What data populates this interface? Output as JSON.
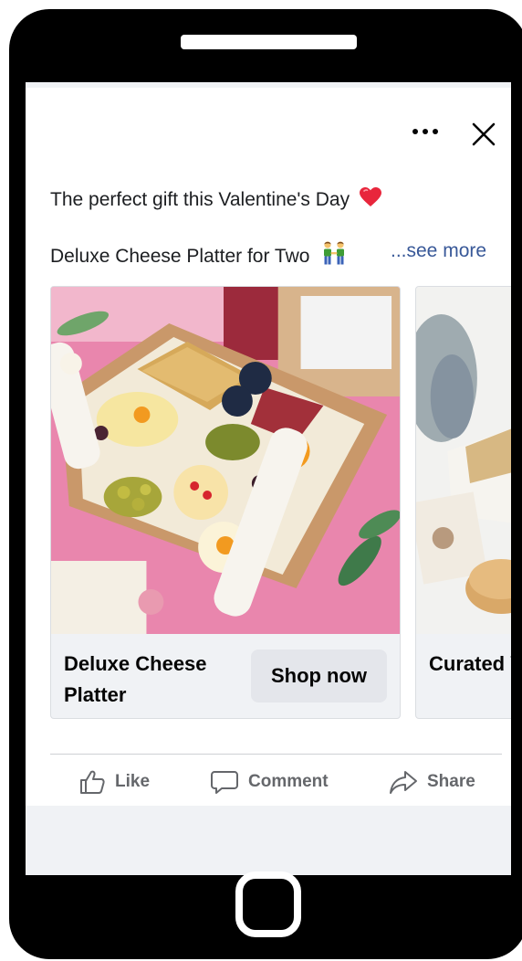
{
  "post": {
    "line1": "The perfect gift this Valentine's Day",
    "line1_emoji": "red-heart",
    "line2": "Deluxe Cheese Platter for Two",
    "line2_emoji": "couple-holding-hands",
    "see_more": "...see more"
  },
  "header": {
    "more_icon": "more-options-icon",
    "close_icon": "close-icon"
  },
  "carousel": {
    "cards": [
      {
        "title": "Deluxe Cheese Platter",
        "button": "Shop now",
        "image": "cheese-platter-photo"
      },
      {
        "title": "Curated Valentine",
        "image": "gift-box-photo"
      }
    ]
  },
  "actions": {
    "like": "Like",
    "comment": "Comment",
    "share": "Share"
  },
  "colors": {
    "link": "#385898",
    "text": "#1c1e21",
    "secondary": "#65676b",
    "button_bg": "#e4e6eb",
    "card_bg": "#f0f2f5"
  }
}
